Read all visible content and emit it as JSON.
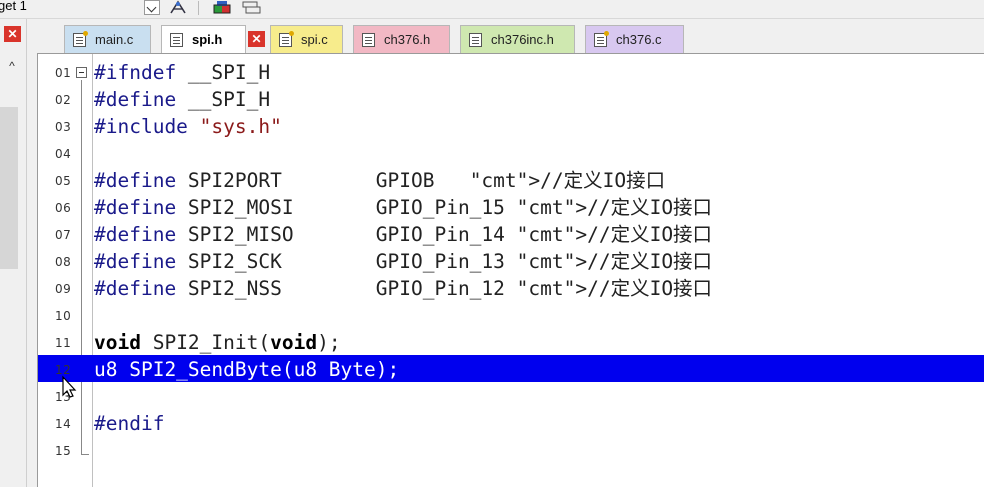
{
  "toolbar": {
    "target_label": "get 1"
  },
  "tabs": [
    {
      "label": "main.c",
      "active": false,
      "icon": "c-file-icon",
      "bg": "#c9dff0"
    },
    {
      "label": "spi.h",
      "active": true,
      "icon": "h-file-icon",
      "bg": "#ffffff"
    },
    {
      "label": "spi.c",
      "active": false,
      "icon": "c-file-icon",
      "bg": "#f7ec8c"
    },
    {
      "label": "ch376.h",
      "active": false,
      "icon": "h-file-icon",
      "bg": "#f2b8c4"
    },
    {
      "label": "ch376inc.h",
      "active": false,
      "icon": "h-file-icon",
      "bg": "#cfe8b0"
    },
    {
      "label": "ch376.c",
      "active": false,
      "icon": "c-file-icon",
      "bg": "#d8c8f0"
    }
  ],
  "editor": {
    "lines": [
      {
        "num": "01",
        "code": "#ifndef __SPI_H"
      },
      {
        "num": "02",
        "code": "#define __SPI_H"
      },
      {
        "num": "03",
        "code": "#include \"sys.h\""
      },
      {
        "num": "04",
        "code": ""
      },
      {
        "num": "05",
        "code": "#define SPI2PORT        GPIOB   //定义IO接口"
      },
      {
        "num": "06",
        "code": "#define SPI2_MOSI       GPIO_Pin_15 //定义IO接口"
      },
      {
        "num": "07",
        "code": "#define SPI2_MISO       GPIO_Pin_14 //定义IO接口"
      },
      {
        "num": "08",
        "code": "#define SPI2_SCK        GPIO_Pin_13 //定义IO接口"
      },
      {
        "num": "09",
        "code": "#define SPI2_NSS        GPIO_Pin_12 //定义IO接口"
      },
      {
        "num": "10",
        "code": ""
      },
      {
        "num": "11",
        "code": "void SPI2_Init(void);"
      },
      {
        "num": "12",
        "code": "u8 SPI2_SendByte(u8 Byte);",
        "highlight": true
      },
      {
        "num": "13",
        "code": ""
      },
      {
        "num": "14",
        "code": "#endif"
      },
      {
        "num": "15",
        "code": ""
      }
    ]
  },
  "colors": {
    "selection": "#0000ee",
    "comment": "#2e8b8b",
    "string": "#8b1a1a",
    "preprocessor": "#1a1a8a"
  }
}
